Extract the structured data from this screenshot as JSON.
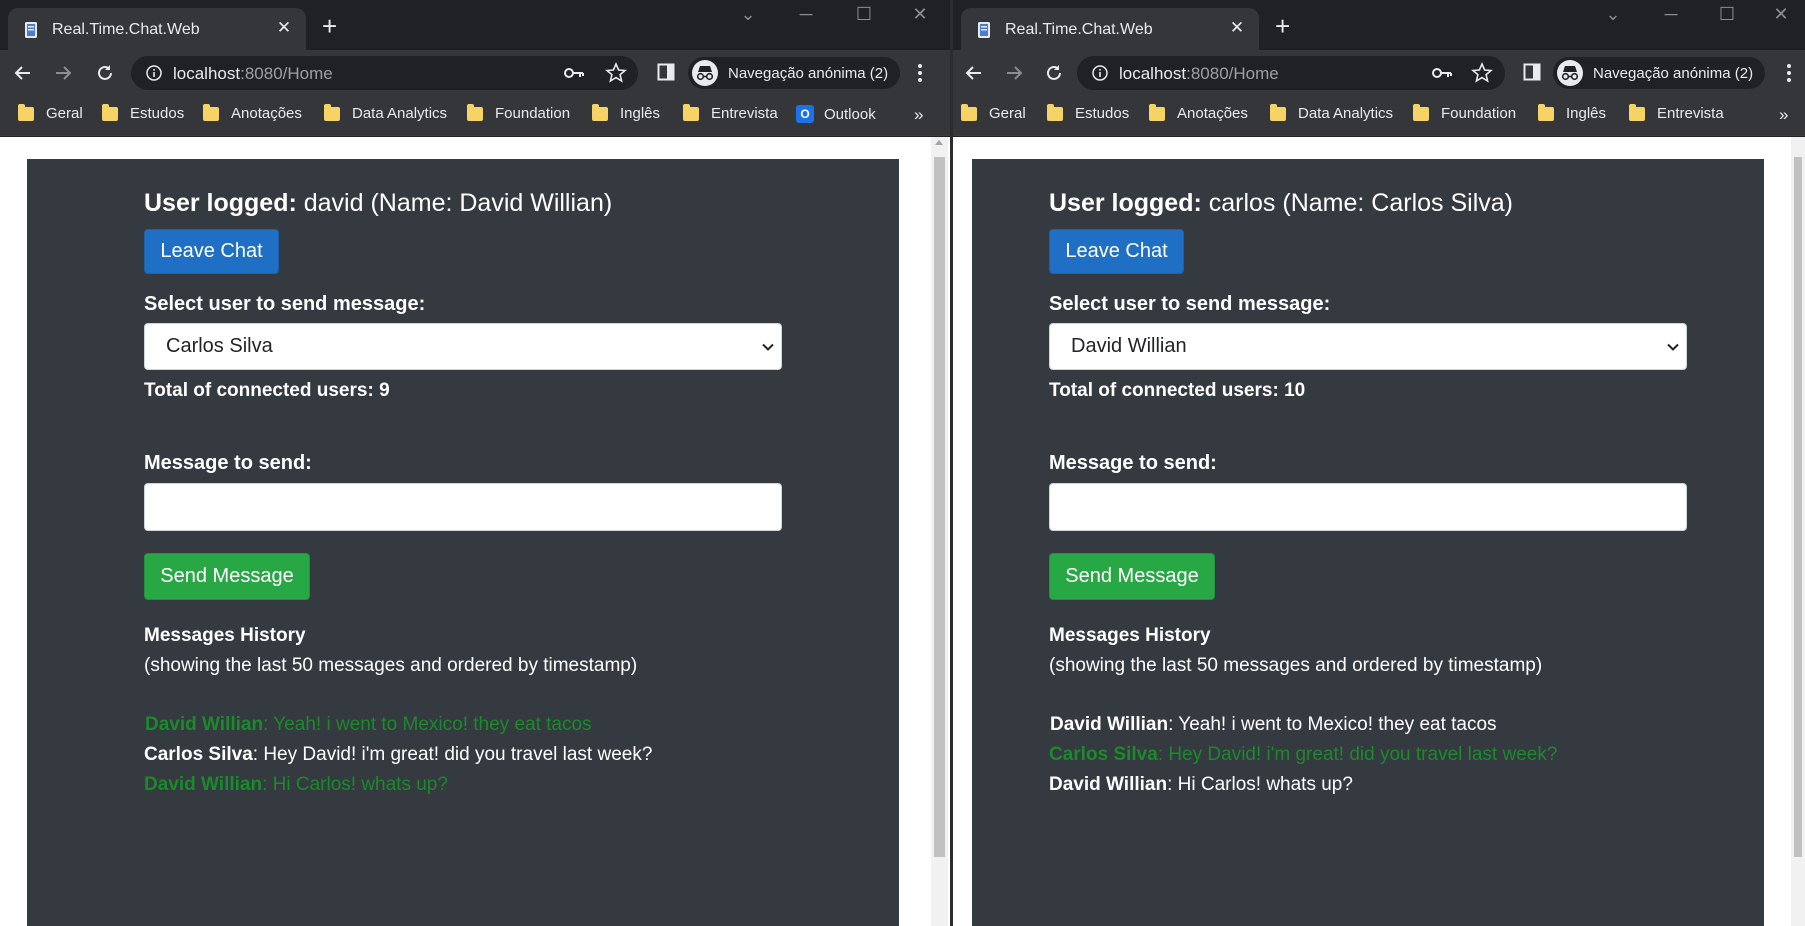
{
  "windows": {
    "left": {
      "tab_title": "Real.Time.Chat.Web",
      "url_host": "localhost",
      "url_rest": ":8080/Home",
      "incognito_label": "Navegação anónima (2)",
      "bookmarks": [
        "Geral",
        "Estudos",
        "Anotações",
        "Data Analytics",
        "Foundation",
        "Inglês",
        "Entrevista",
        "Outlook"
      ],
      "bookmarks_more": "»",
      "user_logged_label": "User logged:",
      "user_logged_value": "david (Name: David Willian)",
      "leave_button": "Leave Chat",
      "select_label": "Select user to send message:",
      "selected_user": "Carlos Silva",
      "connected_users": "Total of connected users: 9",
      "message_label": "Message to send:",
      "message_value": "",
      "send_button": "Send Message",
      "history_title": "Messages History",
      "history_subtitle": "(showing the last 50 messages and ordered by timestamp)",
      "messages": [
        {
          "sender": "David Willian",
          "text": ": Yeah! i went to Mexico! they eat tacos",
          "own": true
        },
        {
          "sender": "Carlos Silva",
          "text": ": Hey David! i'm great! did you travel last week?",
          "own": false
        },
        {
          "sender": "David Willian",
          "text": ": Hi Carlos! whats up?",
          "own": true
        }
      ]
    },
    "right": {
      "tab_title": "Real.Time.Chat.Web",
      "url_host": "localhost",
      "url_rest": ":8080/Home",
      "incognito_label": "Navegação anónima (2)",
      "bookmarks": [
        "Geral",
        "Estudos",
        "Anotações",
        "Data Analytics",
        "Foundation",
        "Inglês",
        "Entrevista"
      ],
      "bookmarks_more": "»",
      "user_logged_label": "User logged:",
      "user_logged_value": "carlos (Name: Carlos Silva)",
      "leave_button": "Leave Chat",
      "select_label": "Select user to send message:",
      "selected_user": "David Willian",
      "connected_users": "Total of connected users: 10",
      "message_label": "Message to send:",
      "message_value": "",
      "send_button": "Send Message",
      "history_title": "Messages History",
      "history_subtitle": "(showing the last 50 messages and ordered by timestamp)",
      "messages": [
        {
          "sender": "David Willian",
          "text": ": Yeah! i went to Mexico! they eat tacos",
          "own": false
        },
        {
          "sender": "Carlos Silva",
          "text": ": Hey David! i'm great! did you travel last week?",
          "own": true
        },
        {
          "sender": "David Willian",
          "text": ": Hi Carlos! whats up?",
          "own": false
        }
      ]
    }
  },
  "colors": {
    "panel": "#343a40",
    "own_message": "#1a8a2a",
    "leave_button": "#1f6fc5",
    "send_button": "#28a745"
  }
}
